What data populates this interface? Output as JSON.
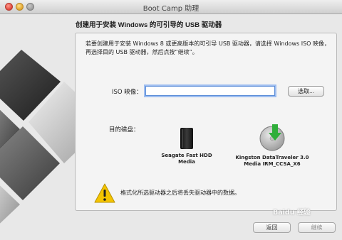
{
  "window": {
    "title": "Boot Camp 助理"
  },
  "heading": "创建用于安装 Windows 的可引导的 USB 驱动器",
  "description": "若要创建用于安装 Windows 8 或更高版本的可引导 USB 驱动器，请选择 Windows ISO 映像，再选择目的 USB 驱动器，然后点按“继续”。",
  "iso": {
    "label": "ISO 映像：",
    "value": "",
    "choose_label": "选取..."
  },
  "destination": {
    "label": "目的磁盘：",
    "drives": [
      {
        "name": "Seagate Fast HDD Media",
        "icon": "external-hdd-icon"
      },
      {
        "name": "Kingston DataTraveler 3.0 Media IRM_CCSA_X6",
        "icon": "usb-drive-install-icon"
      }
    ]
  },
  "warning": {
    "text": "格式化所选驱动器之后将丢失驱动器中的数据。",
    "icon": "warning-icon"
  },
  "buttons": {
    "back": "返回",
    "continue": "继续"
  },
  "watermark": "Baidu 经验",
  "colors": {
    "accent": "#5e8fd8",
    "warning": "#f4c400",
    "install_arrow": "#2fae3a"
  }
}
